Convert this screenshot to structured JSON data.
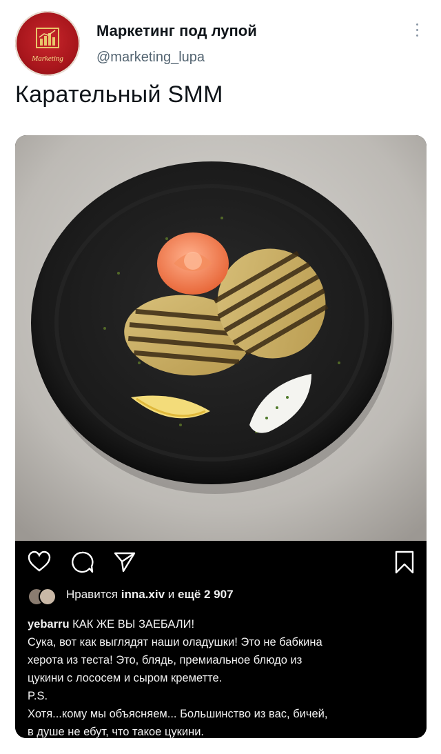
{
  "tweet": {
    "author_name": "Маркетинг под лупой",
    "author_handle": "@marketing_lupa",
    "avatar_label": "Marketing",
    "text": "Карательный SMM"
  },
  "instagram": {
    "likes": {
      "prefix": "Нравится ",
      "user": "inna.xiv",
      "middle": " и ",
      "count": "ещё 2 907"
    },
    "caption": {
      "username": "yebarru",
      "headline": " КАК ЖЕ ВЫ ЗАЕБАЛИ!",
      "lines": [
        "Сука, вот как выглядят наши оладушки! Это не бабкина",
        "херота из теста! Это, блядь, премиальное блюдо из",
        "цукини с лососем и сыром креметте.",
        "P.S.",
        "Хотя...кому мы объясняем... Большинство из вас, бичей,",
        "в душе не ебут, что такое цукини."
      ]
    }
  },
  "colors": {
    "avatar_red": "#a8161c",
    "handle_gray": "#536471",
    "ig_background": "#000000"
  },
  "icons": [
    "more-vertical-icon",
    "heart-icon",
    "comment-icon",
    "share-icon",
    "bookmark-icon"
  ]
}
